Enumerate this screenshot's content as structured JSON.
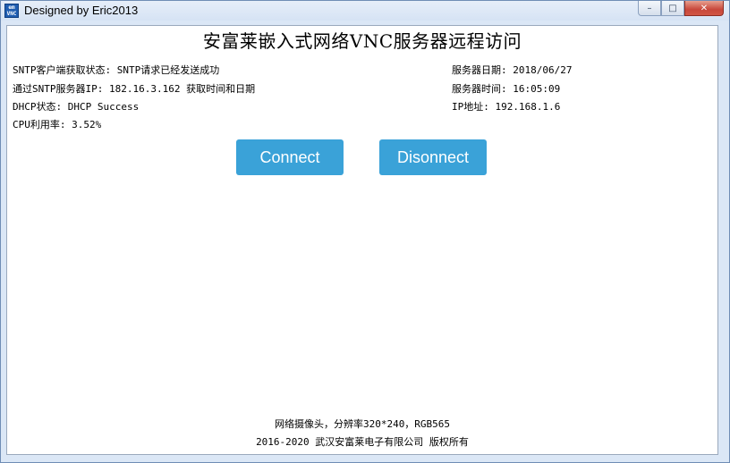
{
  "window": {
    "title": "Designed by Eric2013",
    "icon_label": "emWin VNC",
    "controls": {
      "minimize": "–",
      "maximize": "□",
      "close": "✕"
    }
  },
  "main": {
    "title": "安富莱嵌入式网络VNC服务器远程访问",
    "left_info": [
      "SNTP客户端获取状态: SNTP请求已经发送成功",
      "通过SNTP服务器IP: 182.16.3.162 获取时间和日期",
      "DHCP状态: DHCP Success",
      "CPU利用率: 3.52%"
    ],
    "right_info": [
      "服务器日期: 2018/06/27",
      "服务器时间: 16:05:09",
      "IP地址: 192.168.1.6"
    ],
    "buttons": {
      "connect": "Connect",
      "disconnect": "Disonnect"
    }
  },
  "footer": {
    "line1": "网络摄像头，分辨率320*240，RGB565",
    "line2": "2016-2020 武汉安富莱电子有限公司 版权所有"
  },
  "colors": {
    "button_bg": "#3aa2d8",
    "frame_bg": "#dbe7f6",
    "close_button": "#c8473a"
  }
}
